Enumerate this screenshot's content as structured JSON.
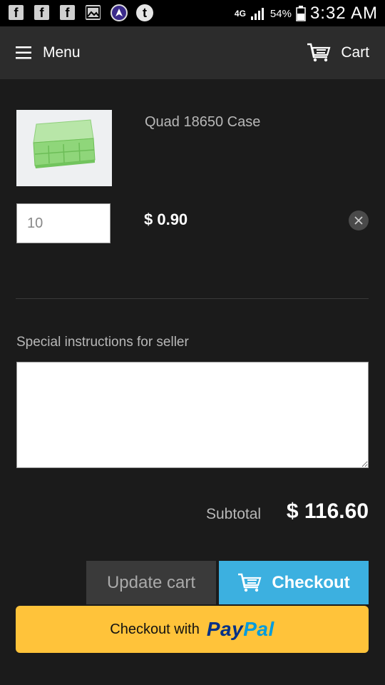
{
  "statusbar": {
    "network": "4G",
    "battery": "54%",
    "time": "3:32 AM"
  },
  "header": {
    "menu_label": "Menu",
    "cart_label": "Cart"
  },
  "cart": {
    "item_title": "Quad 18650 Case",
    "item_qty": "10",
    "item_price": "$ 0.90",
    "instructions_label": "Special instructions for seller",
    "subtotal_label": "Subtotal",
    "subtotal_value": "$ 116.60",
    "update_label": "Update cart",
    "checkout_label": "Checkout",
    "paypal_prefix": "Checkout with",
    "paypal_logo_part1": "Pay",
    "paypal_logo_part2": "Pal"
  },
  "colors": {
    "background": "#1b1b1b",
    "header": "#2c2c2c",
    "checkout": "#3cb0e0",
    "paypal": "#ffc33a"
  }
}
